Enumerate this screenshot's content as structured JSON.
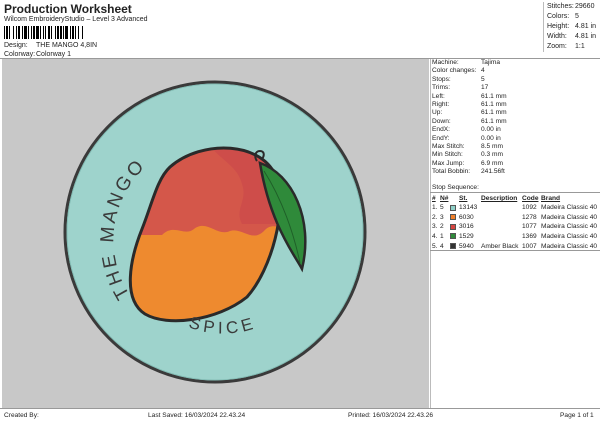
{
  "header": {
    "title": "Production Worksheet",
    "software": "Wilcom EmbroideryStudio – Level 3 Advanced"
  },
  "design_meta": {
    "design_label": "Design:",
    "design_value": "THE MANGO 4,8IN",
    "colorway_label": "Colorway:",
    "colorway_value": "Colorway 1"
  },
  "stats": [
    {
      "label": "Stitches:",
      "value": "29660"
    },
    {
      "label": "Colors:",
      "value": "5"
    },
    {
      "label": "Height:",
      "value": "4.81 in"
    },
    {
      "label": "Width:",
      "value": "4.81 in"
    },
    {
      "label": "Zoom:",
      "value": "1:1"
    }
  ],
  "machine_info": [
    {
      "label": "Machine:",
      "value": "Tajima"
    },
    {
      "label": "Color changes:",
      "value": "4"
    },
    {
      "label": "Stops:",
      "value": "5"
    },
    {
      "label": "Trims:",
      "value": "17"
    },
    {
      "label": "Left:",
      "value": "61.1 mm"
    },
    {
      "label": "Right:",
      "value": "61.1 mm"
    },
    {
      "label": "Up:",
      "value": "61.1 mm"
    },
    {
      "label": "Down:",
      "value": "61.1 mm"
    },
    {
      "label": "EndX:",
      "value": "0.00 in"
    },
    {
      "label": "EndY:",
      "value": "0.00 in"
    },
    {
      "label": "Max Stitch:",
      "value": "8.5 mm"
    },
    {
      "label": "Min Stitch:",
      "value": "0.3 mm"
    },
    {
      "label": "Max Jump:",
      "value": "6.9 mm"
    },
    {
      "label": "Total Bobbin:",
      "value": "241.56ft"
    }
  ],
  "stop_sequence": {
    "title": "Stop Sequence:",
    "headers": [
      "#",
      "N#",
      "",
      "St.",
      "Description",
      "Code",
      "Brand"
    ],
    "rows": [
      {
        "num": "1.",
        "n": "5",
        "color": "#8fd0c8",
        "st": "13143",
        "desc": "",
        "code": "1092",
        "brand": "Madeira Classic 40"
      },
      {
        "num": "2.",
        "n": "3",
        "color": "#f07f2a",
        "st": "6030",
        "desc": "",
        "code": "1278",
        "brand": "Madeira Classic 40"
      },
      {
        "num": "3.",
        "n": "2",
        "color": "#d64541",
        "st": "3016",
        "desc": "",
        "code": "1077",
        "brand": "Madeira Classic 40"
      },
      {
        "num": "4.",
        "n": "1",
        "color": "#2f8a3a",
        "st": "1529",
        "desc": "",
        "code": "1369",
        "brand": "Madeira Classic 40"
      },
      {
        "num": "5.",
        "n": "4",
        "color": "#333333",
        "st": "5940",
        "desc": "Amber Black",
        "code": "1007",
        "brand": "Madeira Classic 40"
      }
    ]
  },
  "design_text": {
    "arc_top": "THE MANGO",
    "arc_bottom": "SPICE"
  },
  "footer": {
    "created_by": "Created By:",
    "last_saved": "Last Saved: 16/03/2024 22.43.24",
    "printed": "Printed: 16/03/2024 22.43.26",
    "page": "Page 1 of 1"
  },
  "colors": {
    "badge_fill": "#9ed3cc",
    "badge_border": "#3a3a3a",
    "mango_orange": "#ee8a2f",
    "mango_red": "#d4574a",
    "leaf_green": "#2f8a3a"
  }
}
